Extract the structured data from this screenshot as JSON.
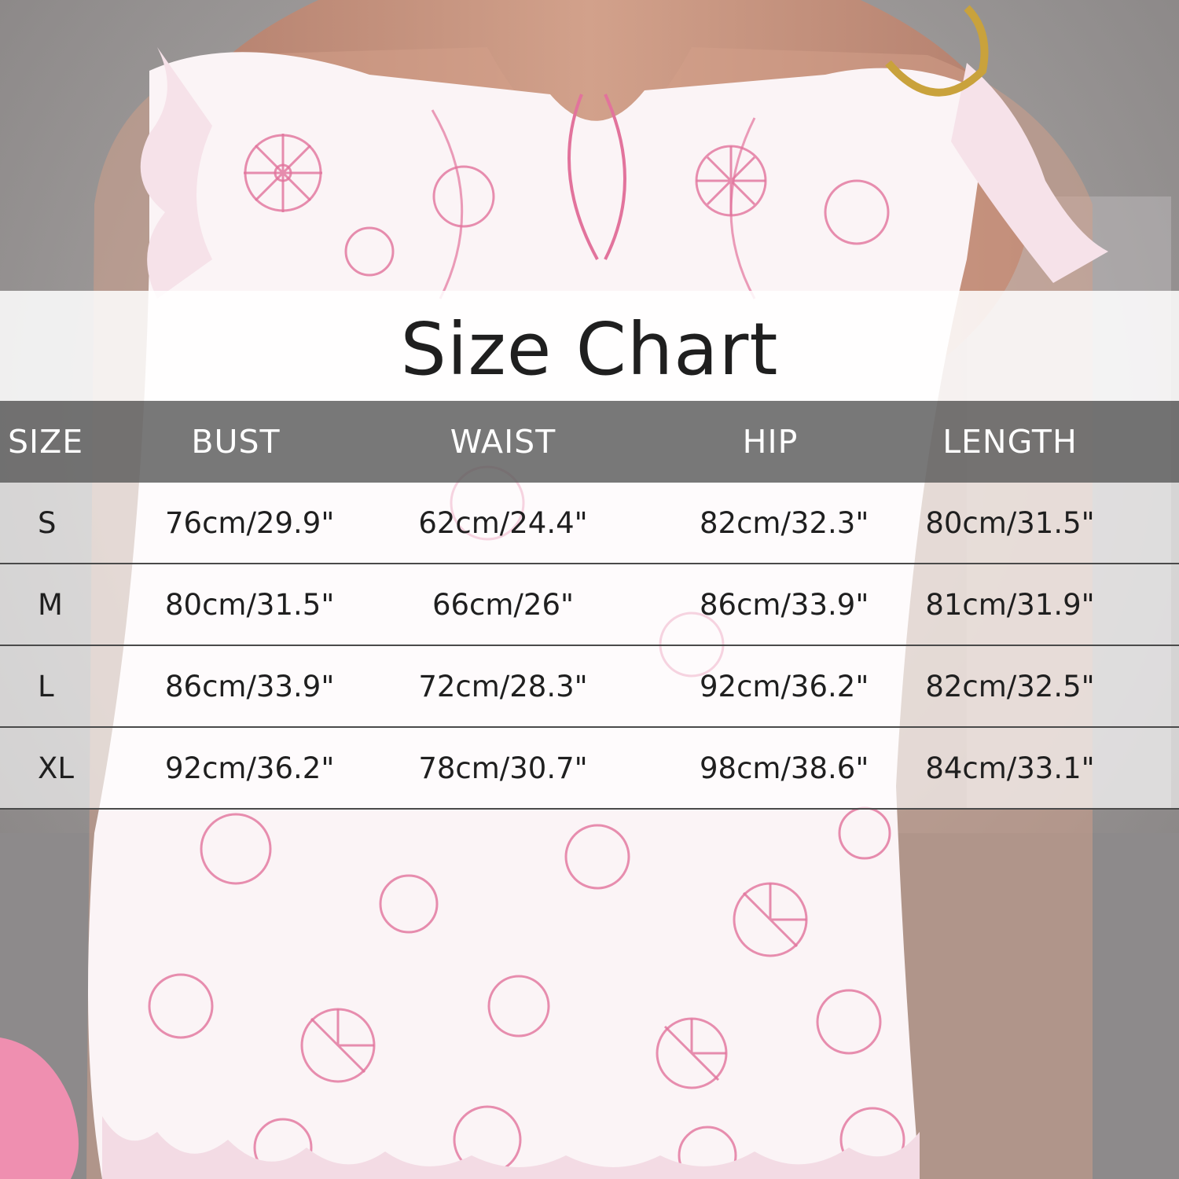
{
  "title": "Size Chart",
  "colors": {
    "header_bg": "#6e6e6e",
    "fabric": "#fbf4f6",
    "print": "#e2739c",
    "skin": "#c69079"
  },
  "table": {
    "headers": [
      "SIZE",
      "BUST",
      "WAIST",
      "HIP",
      "LENGTH"
    ],
    "rows": [
      [
        "S",
        "76cm/29.9\"",
        "62cm/24.4\"",
        "82cm/32.3\"",
        "80cm/31.5\""
      ],
      [
        "M",
        "80cm/31.5\"",
        "66cm/26\"",
        "86cm/33.9\"",
        "81cm/31.9\""
      ],
      [
        "L",
        "86cm/33.9\"",
        "72cm/28.3\"",
        "92cm/36.2\"",
        "82cm/32.5\""
      ],
      [
        "XL",
        "92cm/36.2\"",
        "78cm/30.7\"",
        "98cm/38.6\"",
        "84cm/33.1\""
      ]
    ]
  }
}
